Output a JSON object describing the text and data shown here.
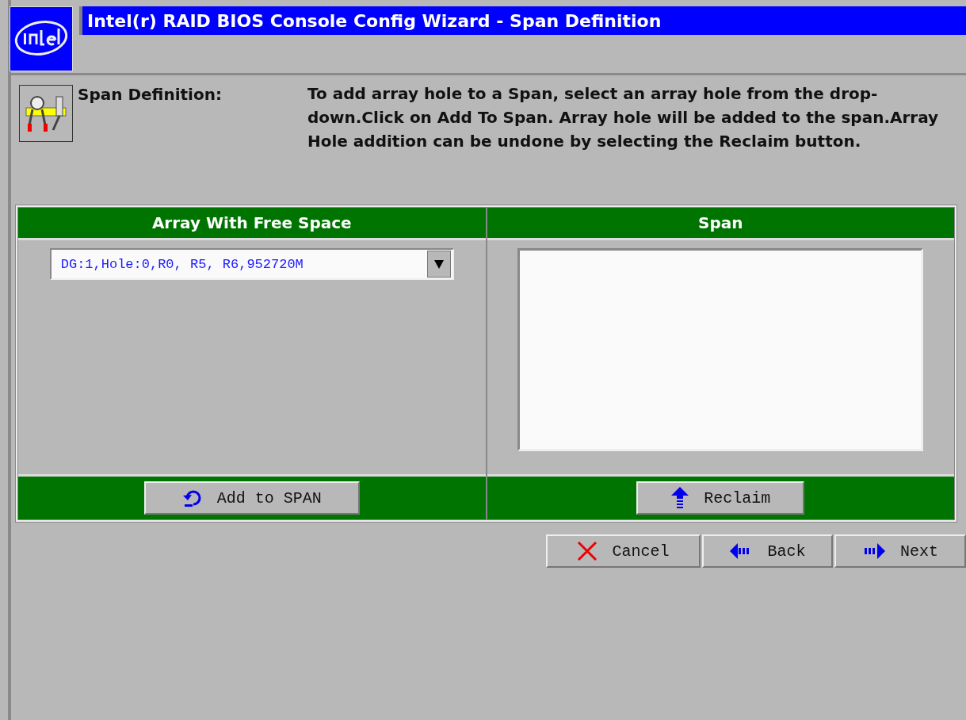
{
  "window": {
    "title": "Intel(r) RAID BIOS Console Config Wizard - Span Definition"
  },
  "intro": {
    "label": "Span Definition:",
    "text": "To add array hole to a Span, select an array hole from the drop-down.Click on Add To Span. Array hole will be added to the span.Array Hole addition can be undone by selecting the Reclaim button."
  },
  "panels": [
    {
      "heading": "Array With Free Space",
      "kind": "dropdown",
      "value": "DG:1,Hole:0,R0, R5, R6,952720M",
      "button": {
        "label": "Add to SPAN",
        "kind": "add"
      }
    },
    {
      "heading": "Span",
      "kind": "listbox",
      "button": {
        "label": "Reclaim",
        "kind": "reclaim"
      }
    }
  ],
  "buttons": [
    {
      "label": "Cancel",
      "kind": "cancel"
    },
    {
      "label": "Back",
      "kind": "back"
    },
    {
      "label": "Next",
      "kind": "next"
    }
  ]
}
